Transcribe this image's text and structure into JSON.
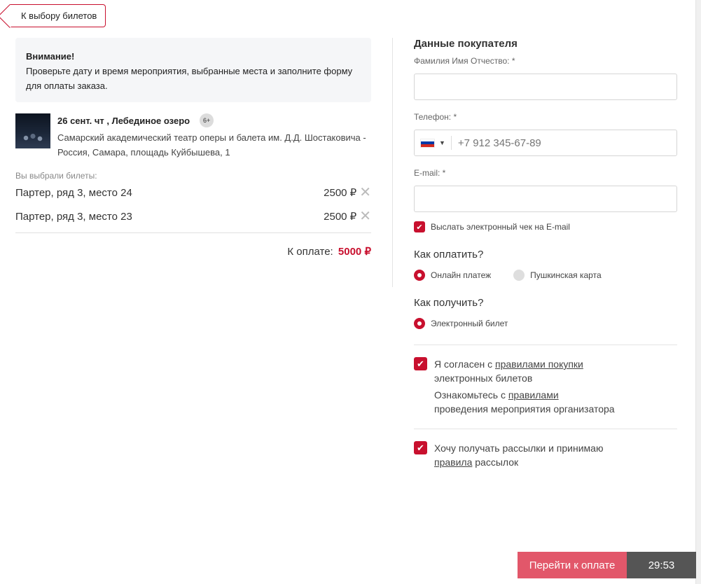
{
  "back_button": {
    "label": "К выбору билетов"
  },
  "notice": {
    "title": "Внимание!",
    "text": "Проверьте дату и время мероприятия, выбранные места и заполните форму для оплаты заказа."
  },
  "event": {
    "title": "26 сент. чт , Лебединое озеро",
    "age_rating": "6+",
    "venue": "Самарский академический театр оперы и балета им. Д.Д. Шостаковича - Россия, Самара, площадь Куйбышева, 1"
  },
  "tickets": {
    "label": "Вы выбрали билеты:",
    "items": [
      {
        "seat": "Партер, ряд 3, место 24",
        "price": "2500 ₽"
      },
      {
        "seat": "Партер, ряд 3, место 23",
        "price": "2500 ₽"
      }
    ],
    "total_label": "К оплате:",
    "total_value": "5000 ₽"
  },
  "buyer": {
    "title": "Данные покупателя",
    "name_label": "Фамилия Имя Отчество: *",
    "name_value": "",
    "phone_label": "Телефон: *",
    "phone_placeholder": "+7 912 345-67-89",
    "email_label": "E-mail: *",
    "email_value": "",
    "receipt_checkbox": "Выслать электронный чек на E-mail"
  },
  "payment": {
    "title": "Как оплатить?",
    "options": [
      "Онлайн платеж",
      "Пушкинская карта"
    ],
    "selected": "Онлайн платеж"
  },
  "delivery": {
    "title": "Как получить?",
    "options": [
      "Электронный билет"
    ],
    "selected": "Электронный билет"
  },
  "agreements": {
    "rules_prefix": "Я согласен с ",
    "rules_link": "правилами покупки",
    "rules_suffix": "электронных билетов",
    "organizer_prefix": "Ознакомьтесь с ",
    "organizer_link": "правилами",
    "organizer_suffix": "проведения мероприятия организатора",
    "newsletter_text": "Хочу получать рассылки и принимаю",
    "newsletter_link": "правила",
    "newsletter_suffix": " рассылок"
  },
  "footer": {
    "pay_button": "Перейти к оплате",
    "timer": "29:53"
  },
  "colors": {
    "accent": "#c8102e",
    "pay_button": "#e2576a",
    "timer_bg": "#555555",
    "notice_bg": "#f5f6f8"
  },
  "icons": {
    "remove": "close-icon",
    "checkbox": "checkmark-icon",
    "flag": "russia-flag-icon",
    "dropdown": "caret-down-icon"
  }
}
